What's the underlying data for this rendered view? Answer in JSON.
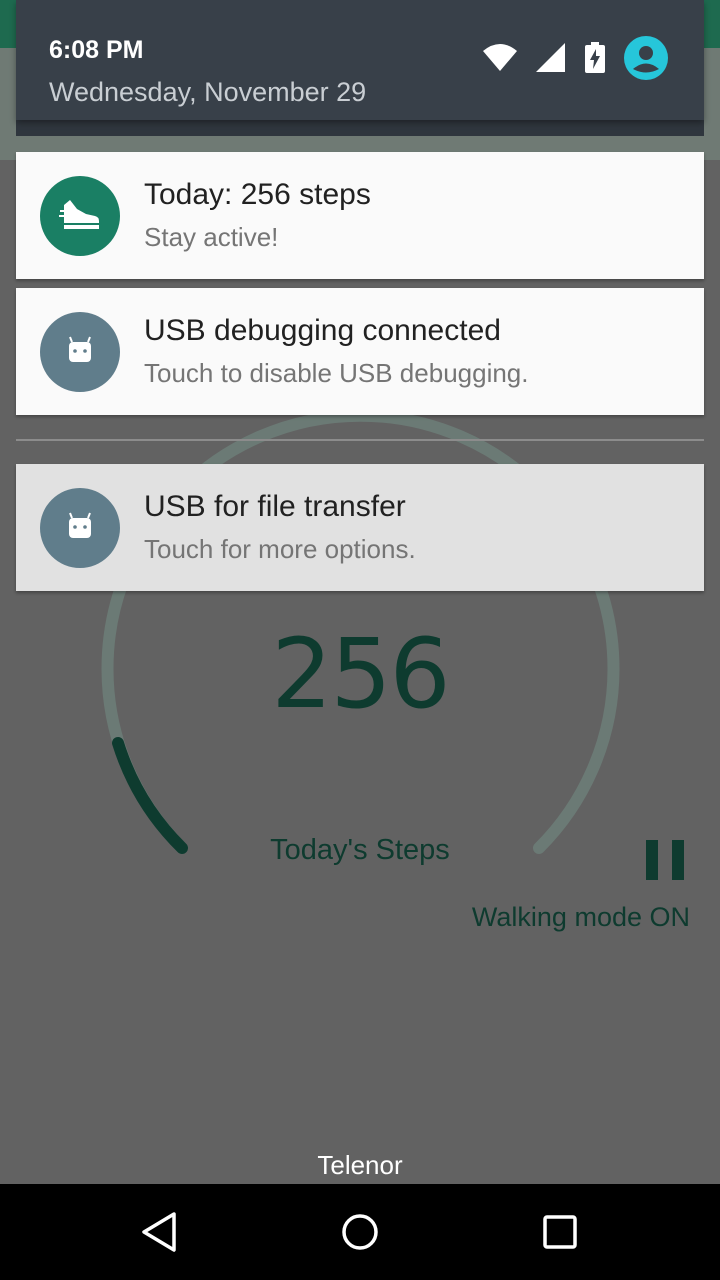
{
  "status_bar": {
    "time": "6:08 PM",
    "date": "Wednesday, November 29",
    "icons": [
      "wifi-icon",
      "cell-signal-icon",
      "battery-charging-icon",
      "user-account-icon"
    ]
  },
  "notifications": [
    {
      "title": "Today: 256 steps",
      "text": "Stay active!",
      "icon": "shoe-icon",
      "icon_color": "#1a7f64"
    },
    {
      "title": "USB debugging connected",
      "text": "Touch to disable USB debugging.",
      "icon": "android-icon",
      "icon_color": "#607d8b"
    },
    {
      "title": "USB for file transfer",
      "text": "Touch for more options.",
      "icon": "android-icon",
      "icon_color": "#607d8b"
    }
  ],
  "app": {
    "steps_today": "256",
    "steps_label": "Today's Steps",
    "walking_mode": "Walking mode ON",
    "progress_fraction": 0.0256
  },
  "carrier": "Telenor",
  "navigation": [
    "back-button",
    "home-button",
    "recents-button"
  ]
}
